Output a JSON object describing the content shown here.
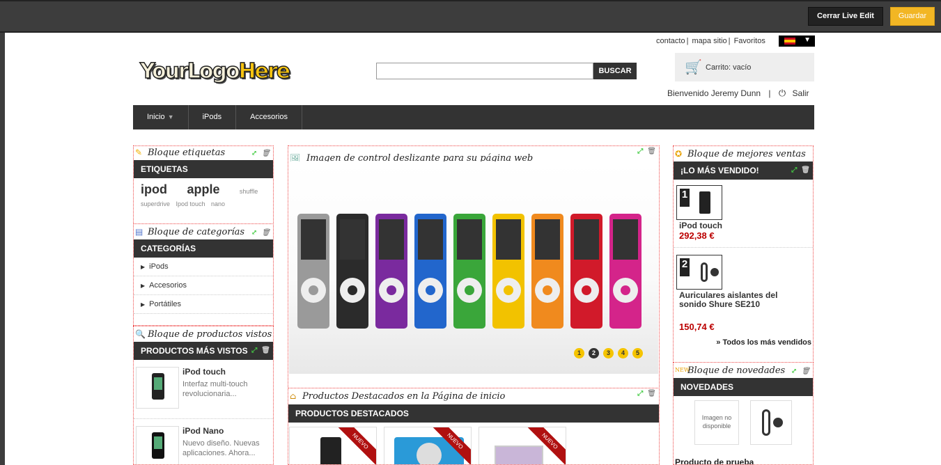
{
  "editbar": {
    "close_label": "Cerrar Live Edit",
    "save_label": "Guardar"
  },
  "header": {
    "links": [
      "contacto",
      "mapa sitio",
      "Favoritos"
    ],
    "search_button": "BUSCAR",
    "cart_text": "Carrito: vacío",
    "welcome_text": "Bienvenido Jeremy Dunn",
    "logout_label": "Salir",
    "logo_part1": "YourLogo",
    "logo_part2": "Here"
  },
  "nav": {
    "items": [
      "Inicio",
      "iPods",
      "Accesorios"
    ]
  },
  "tags_block": {
    "title": "Bloque etiquetas",
    "heading": "ETIQUETAS",
    "tags_big": [
      "ipod",
      "apple"
    ],
    "tags_small": [
      "shuffle",
      "superdrive",
      "Ipod touch",
      "nano"
    ]
  },
  "categories_block": {
    "title": "Bloque de categorías",
    "heading": "CATEGORÍAS",
    "items": [
      "iPods",
      "Accesorios",
      "Portátiles"
    ]
  },
  "viewed_block": {
    "title": "Bloque de productos vistos",
    "heading": "PRODUCTOS MÁS VISTOS",
    "products": [
      {
        "name": "iPod touch",
        "desc": "Interfaz multi-touch revolucionaria..."
      },
      {
        "name": "iPod Nano",
        "desc": "Nuevo diseño. Nuevas aplicaciones. Ahora..."
      }
    ]
  },
  "slider_block": {
    "title": "Imagen de control deslizante para su página web",
    "pages": [
      "1",
      "2",
      "3",
      "4",
      "5"
    ],
    "active_page": 2
  },
  "featured_block": {
    "title": "Productos Destacados en la Página de inicio",
    "heading": "PRODUCTOS DESTACADOS",
    "badge": "NUEVO"
  },
  "bestsellers_block": {
    "title": "Bloque de mejores ventas",
    "heading": "¡LO MÁS VENDIDO!",
    "items": [
      {
        "rank": "1",
        "name": "iPod touch",
        "price": "292,38 €"
      },
      {
        "rank": "2",
        "name": "Auriculares aislantes del sonido Shure SE210",
        "price": "150,74 €"
      }
    ],
    "all_link": "» Todos los más vendidos"
  },
  "news_block": {
    "title": "Bloque de novedades",
    "heading": "NOVEDADES",
    "no_image": "Imagen no disponible",
    "product": "Producto de prueba"
  },
  "colors": {
    "accent": "#f2b624",
    "dark": "#333333",
    "price": "#bb0000",
    "ipods": [
      "#9a9a9a",
      "#2b2b2b",
      "#7a2a9e",
      "#2266cc",
      "#3aa63a",
      "#f2c200",
      "#f08a1e",
      "#d11a2a",
      "#d4248a"
    ]
  }
}
